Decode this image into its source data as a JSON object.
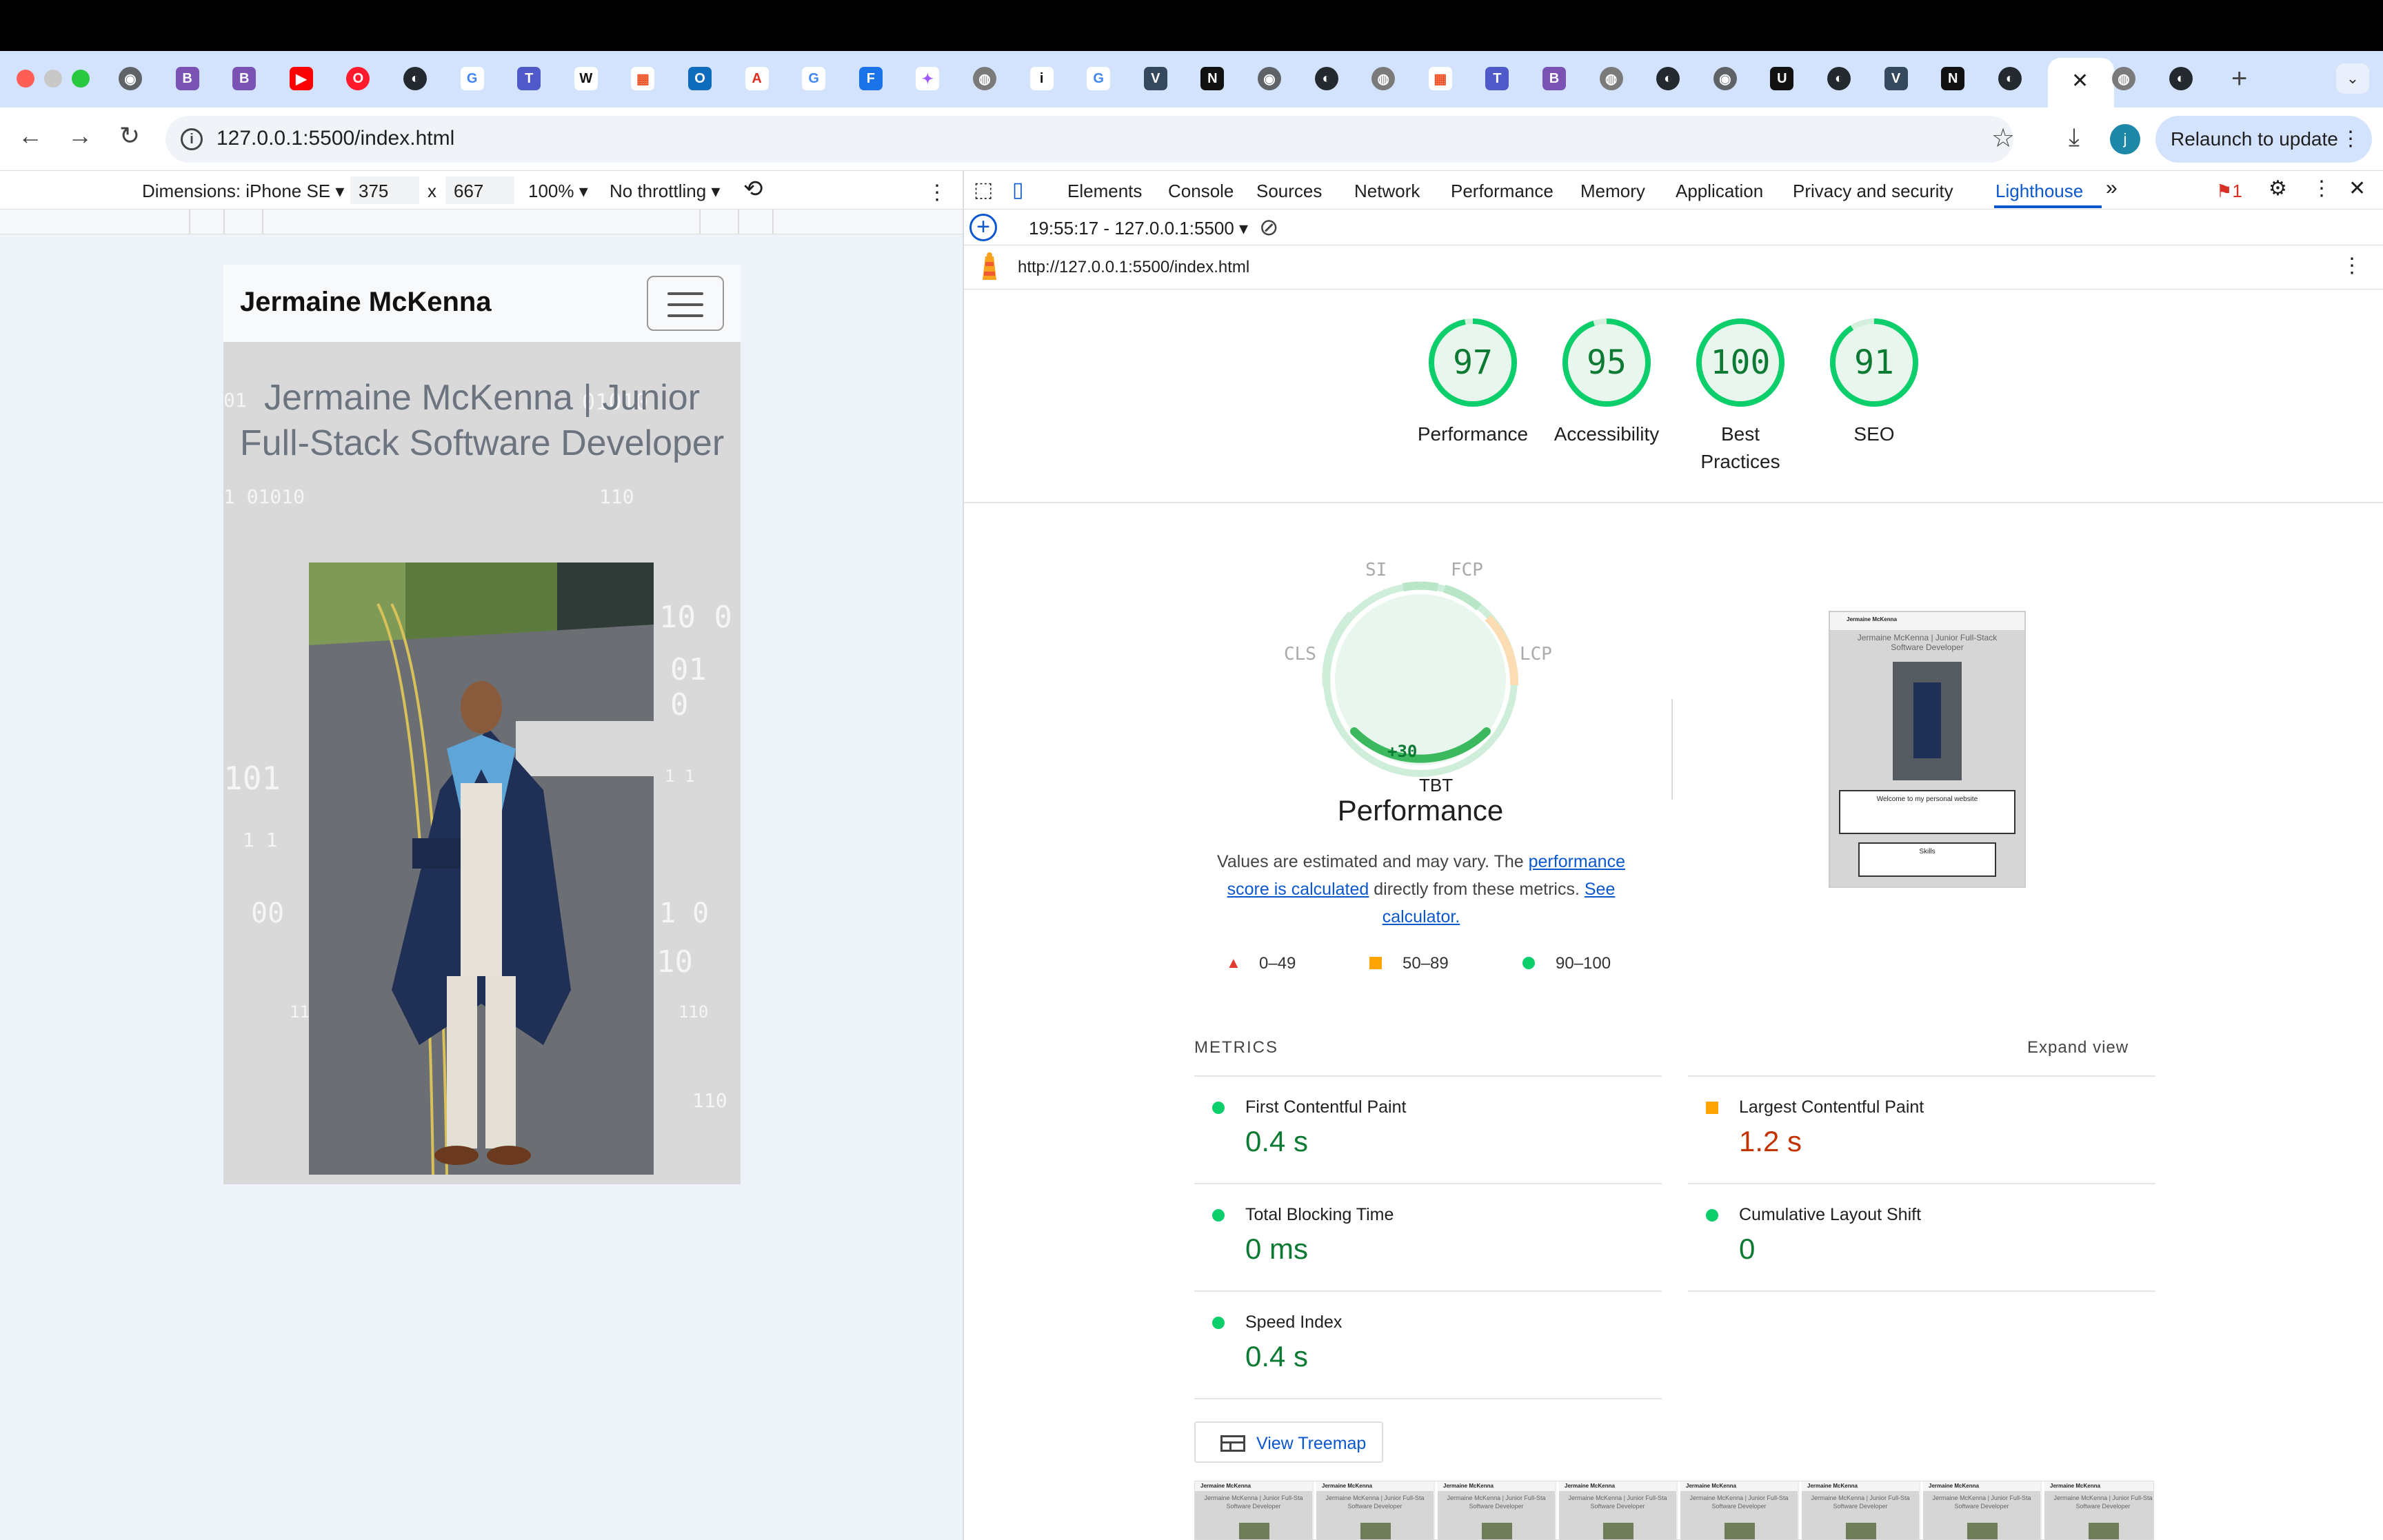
{
  "browser": {
    "url": "127.0.0.1:5500/index.html",
    "relaunch_label": "Relaunch to update",
    "profile_initial": "j",
    "tab_favicons": [
      "chrome",
      "B",
      "B",
      "youtube",
      "opera",
      "github",
      "G",
      "teams",
      "W",
      "microsoft",
      "outlook",
      "acrobat",
      "G",
      "F",
      "figma",
      "globe",
      "i",
      "G",
      "vue",
      "notion",
      "chrome",
      "github",
      "globe",
      "microsoft",
      "teams",
      "B",
      "globe",
      "github",
      "chrome",
      "U",
      "github",
      "vue",
      "notion",
      "github",
      "active-close",
      "globe",
      "github"
    ]
  },
  "device_toolbar": {
    "dimensions_label": "Dimensions: iPhone SE",
    "width": "375",
    "times": "x",
    "height": "667",
    "zoom": "100%",
    "throttling": "No throttling"
  },
  "phone_page": {
    "brand": "Jermaine McKenna",
    "hero_title": "Jermaine McKenna | Junior Full-Stack Software Developer"
  },
  "devtools": {
    "tabs": [
      "Elements",
      "Console",
      "Sources",
      "Network",
      "Performance",
      "Memory",
      "Application",
      "Privacy and security",
      "Lighthouse"
    ],
    "active_tab": "Lighthouse",
    "issues_count": "1",
    "report_time": "19:55:17 - 127.0.0.1:5500",
    "report_url": "http://127.0.0.1:5500/index.html"
  },
  "lighthouse": {
    "gauges": [
      {
        "score": "97",
        "label": "Performance",
        "value": 97
      },
      {
        "score": "95",
        "label": "Accessibility",
        "value": 95
      },
      {
        "score": "100",
        "label": "Best Practices",
        "value": 100
      },
      {
        "score": "91",
        "label": "SEO",
        "value": 91
      }
    ],
    "perf_labels": {
      "si": "SI",
      "fcp": "FCP",
      "cls": "CLS",
      "lcp": "LCP",
      "tbt": "TBT",
      "tbt_delta": "+30"
    },
    "perf_title": "Performance",
    "desc_pre": "Values are estimated and may vary. The ",
    "desc_link1": "performance score is calculated",
    "desc_mid": " directly from these metrics. ",
    "desc_link2": "See calculator.",
    "legend": [
      "0–49",
      "50–89",
      "90–100"
    ],
    "metrics_heading": "METRICS",
    "expand_view": "Expand view",
    "metrics": [
      {
        "name": "First Contentful Paint",
        "value": "0.4 s",
        "status": "good"
      },
      {
        "name": "Largest Contentful Paint",
        "value": "1.2 s",
        "status": "average"
      },
      {
        "name": "Total Blocking Time",
        "value": "0 ms",
        "status": "good"
      },
      {
        "name": "Cumulative Layout Shift",
        "value": "0",
        "status": "good"
      },
      {
        "name": "Speed Index",
        "value": "0.4 s",
        "status": "good"
      }
    ],
    "treemap_label": "View Treemap",
    "thumbnail": {
      "brand": "Jermaine McKenna",
      "title": "Jermaine McKenna | Junior Full-Stack Software Developer",
      "card1": "Welcome to my personal website",
      "card2": "Skills"
    },
    "filmstrip_brand": "Jermaine McKenna",
    "filmstrip_title": "Jermaine McKenna | Junior Full-Sta Software Developer"
  },
  "colors": {
    "good": "#0cce6b",
    "good_text": "#0c7a32",
    "average": "#ffa400",
    "average_text": "#c33300",
    "fail": "#ff4e42",
    "link": "#0b57d0"
  }
}
